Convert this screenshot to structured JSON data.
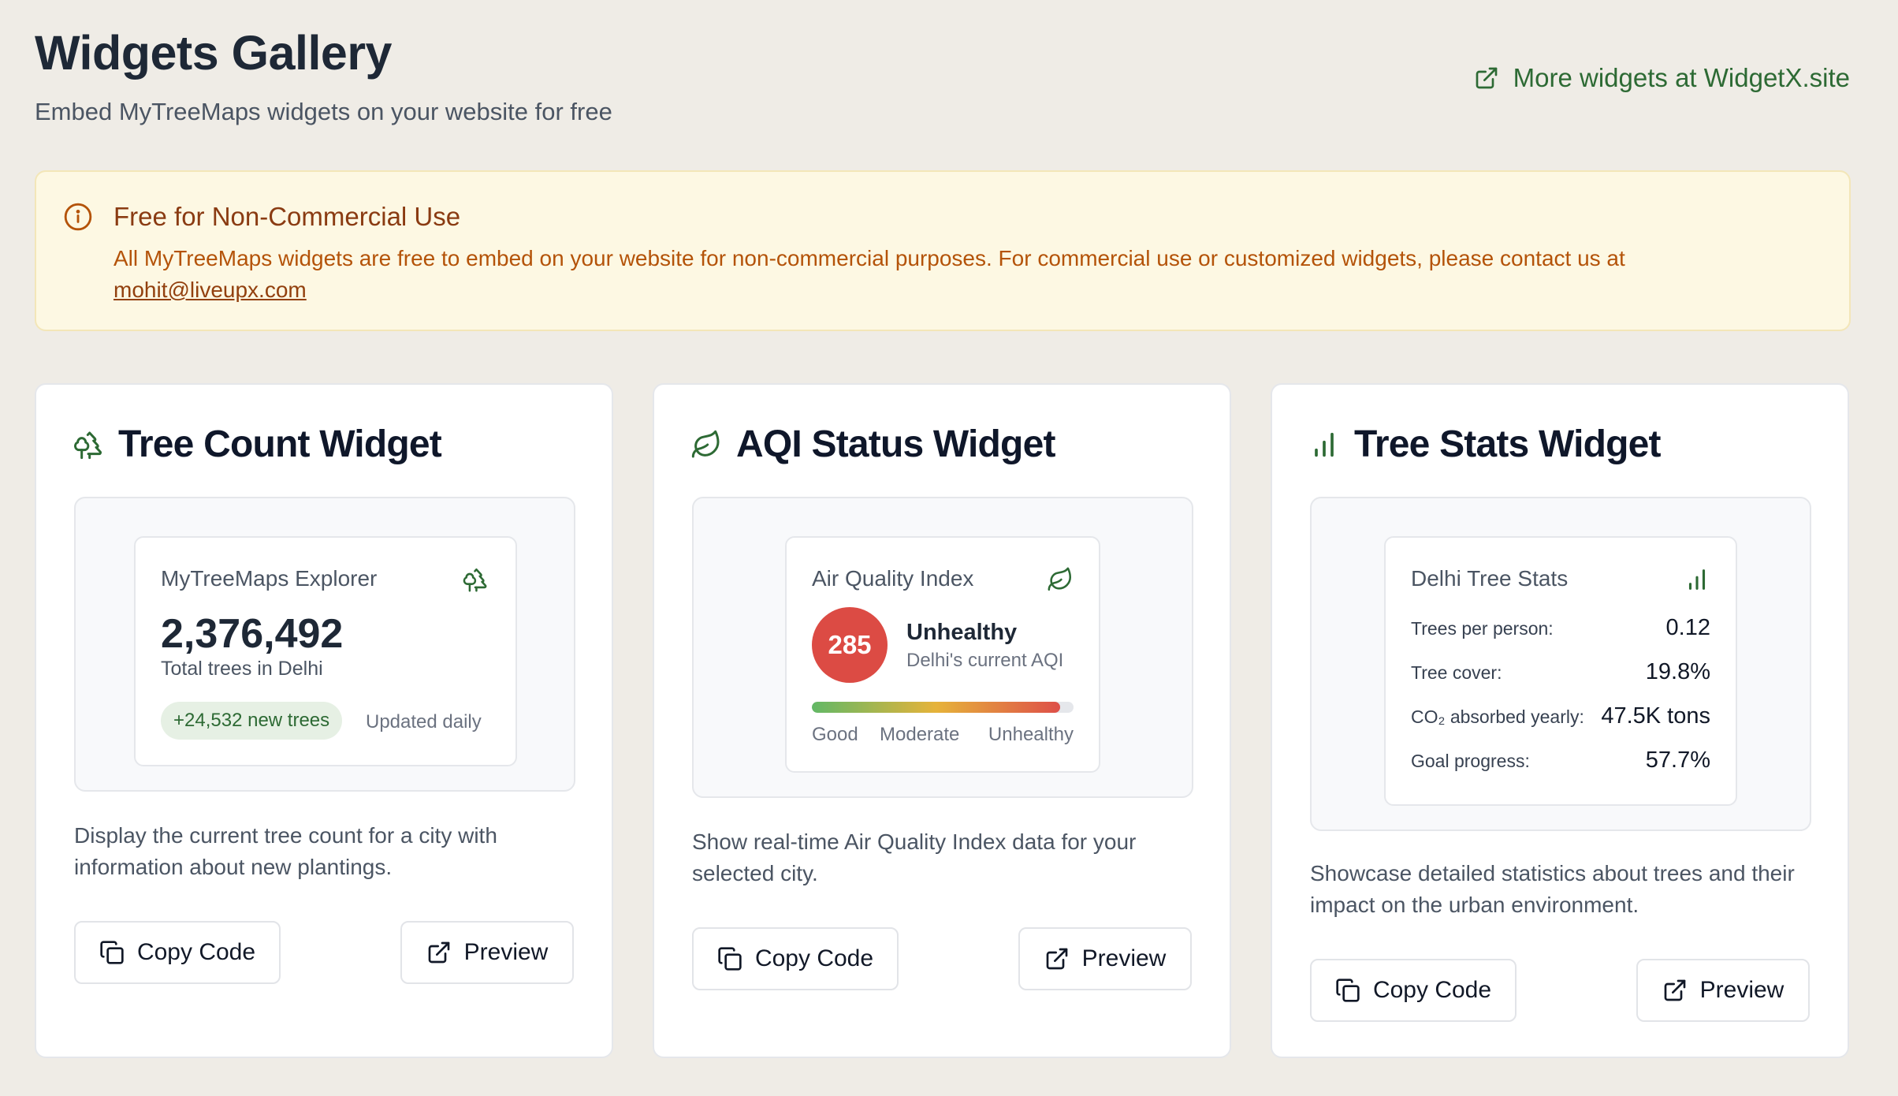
{
  "header": {
    "title": "Widgets Gallery",
    "subtitle": "Embed MyTreeMaps widgets on your website for free",
    "more_link": "More widgets at WidgetX.site"
  },
  "notice": {
    "title": "Free for Non-Commercial Use",
    "body": "All MyTreeMaps widgets are free to embed on your website for non-commercial purposes. For commercial use or customized widgets, please contact us at",
    "email": "mohit@liveupx.com"
  },
  "buttons": {
    "copy": "Copy Code",
    "preview": "Preview"
  },
  "widgets": [
    {
      "title": "Tree Count Widget",
      "icon": "trees-icon",
      "preview": {
        "title": "MyTreeMaps Explorer",
        "count": "2,376,492",
        "count_label": "Total trees in Delhi",
        "badge": "+24,532 new trees",
        "updated": "Updated daily"
      },
      "description": "Display the current tree count for a city with information about new plantings."
    },
    {
      "title": "AQI Status Widget",
      "icon": "leaf-icon",
      "preview": {
        "title": "Air Quality Index",
        "value": "285",
        "status": "Unhealthy",
        "subtitle": "Delhi's current AQI",
        "level": 0.95,
        "scale": [
          "Good",
          "Moderate",
          "Unhealthy"
        ]
      },
      "description": "Show real-time Air Quality Index data for your selected city."
    },
    {
      "title": "Tree Stats Widget",
      "icon": "bar-chart-icon",
      "preview": {
        "title": "Delhi Tree Stats",
        "stats": [
          {
            "label": "Trees per person:",
            "value": "0.12"
          },
          {
            "label": "Tree cover:",
            "value": "19.8%"
          },
          {
            "label": "CO₂ absorbed yearly:",
            "value": "47.5K tons"
          },
          {
            "label": "Goal progress:",
            "value": "57.7%"
          }
        ]
      },
      "description": "Showcase detailed statistics about trees and their impact on the urban environment."
    }
  ],
  "colors": {
    "brand_green": "#2d6a34",
    "aqi_red": "#dc4b44",
    "notice_bg": "#fdf8e3"
  }
}
